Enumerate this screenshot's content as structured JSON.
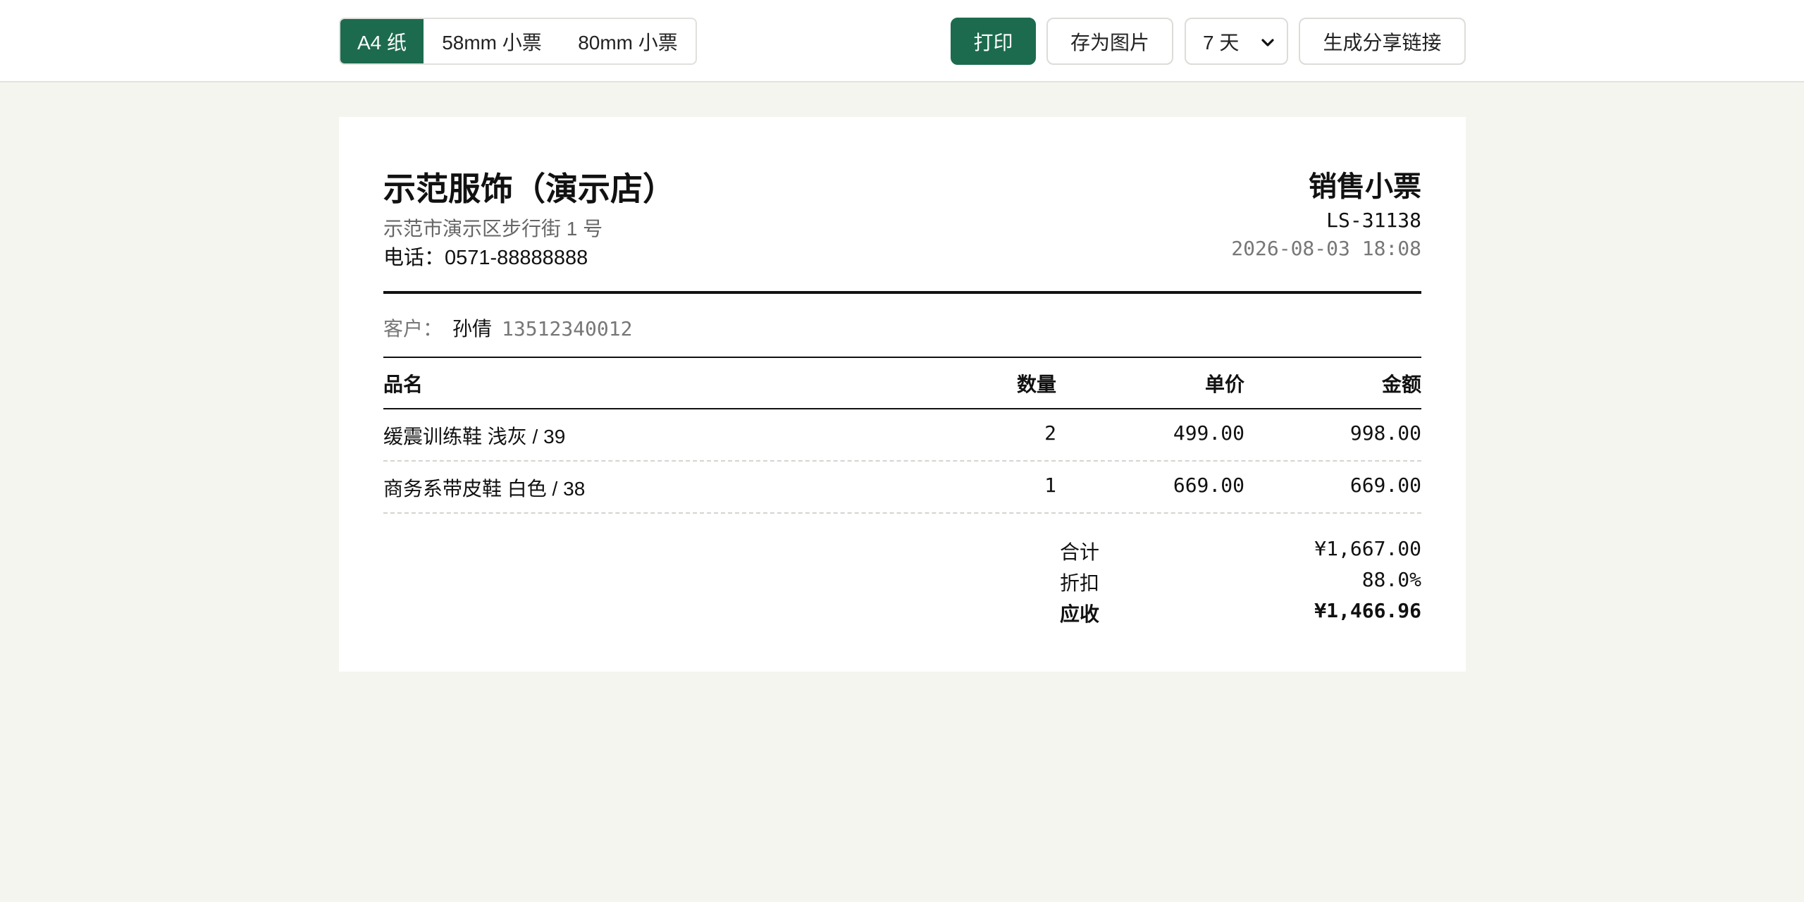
{
  "toolbar": {
    "paper_options": [
      "A4 纸",
      "58mm 小票",
      "80mm 小票"
    ],
    "active_paper": "A4 纸",
    "print_label": "打印",
    "save_image_label": "存为图片",
    "expiry_selected": "7 天",
    "share_link_label": "生成分享链接",
    "accent_color": "#1d6b4f"
  },
  "receipt": {
    "store_name": "示范服饰（演示店）",
    "store_address": "示范市演示区步行街 1 号",
    "store_phone": "电话：0571-88888888",
    "title": "销售小票",
    "number": "LS-31138",
    "datetime": "2026-08-03 18:08",
    "customer_label": "客户：",
    "customer_name": "孙倩",
    "customer_phone": "13512340012",
    "columns": {
      "name": "品名",
      "qty": "数量",
      "price": "单价",
      "amount": "金额"
    },
    "items": [
      {
        "name": "缓震训练鞋 浅灰 / 39",
        "qty": "2",
        "price": "499.00",
        "amount": "998.00"
      },
      {
        "name": "商务系带皮鞋 白色 / 38",
        "qty": "1",
        "price": "669.00",
        "amount": "669.00"
      }
    ],
    "summary": {
      "subtotal_label": "合计",
      "subtotal_value": "¥1,667.00",
      "discount_label": "折扣",
      "discount_value": "88.0%",
      "due_label": "应收",
      "due_value": "¥1,466.96"
    }
  }
}
